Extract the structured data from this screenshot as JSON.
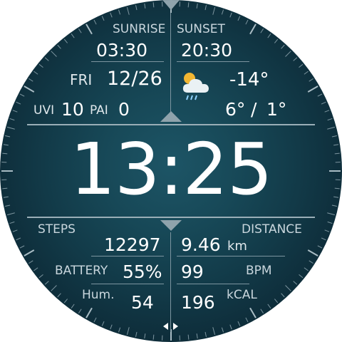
{
  "top": {
    "sunrise_label": "SUNRISE",
    "sunrise_time": "03:30",
    "sunset_label": "SUNSET",
    "sunset_time": "20:30",
    "weekday": "FRI",
    "date": "12/26",
    "weather_icon": "cloud-rain-sun-icon",
    "temperature": "-14°",
    "uvi_label": "UVI",
    "uvi_value": "10",
    "pai_label": "PAI",
    "pai_value": "0",
    "temp_high": "6°",
    "temp_separator": "/",
    "temp_low": "1°"
  },
  "time": "13:25",
  "bottom": {
    "steps_label": "STEPS",
    "steps_value": "12297",
    "distance_label": "DISTANCE",
    "distance_value": "9.46",
    "distance_unit": "km",
    "battery_label": "BATTERY",
    "battery_value": "55%",
    "heart_rate_value": "99",
    "bpm_label": "BPM",
    "humidity_label": "Hum.",
    "humidity_value": "54",
    "calories_value": "196",
    "kcal_label": "kCAL"
  },
  "colors": {
    "background": "#123a48",
    "text": "#ffffff",
    "label": "#c9d6dd",
    "divider": "#7c95a0"
  }
}
